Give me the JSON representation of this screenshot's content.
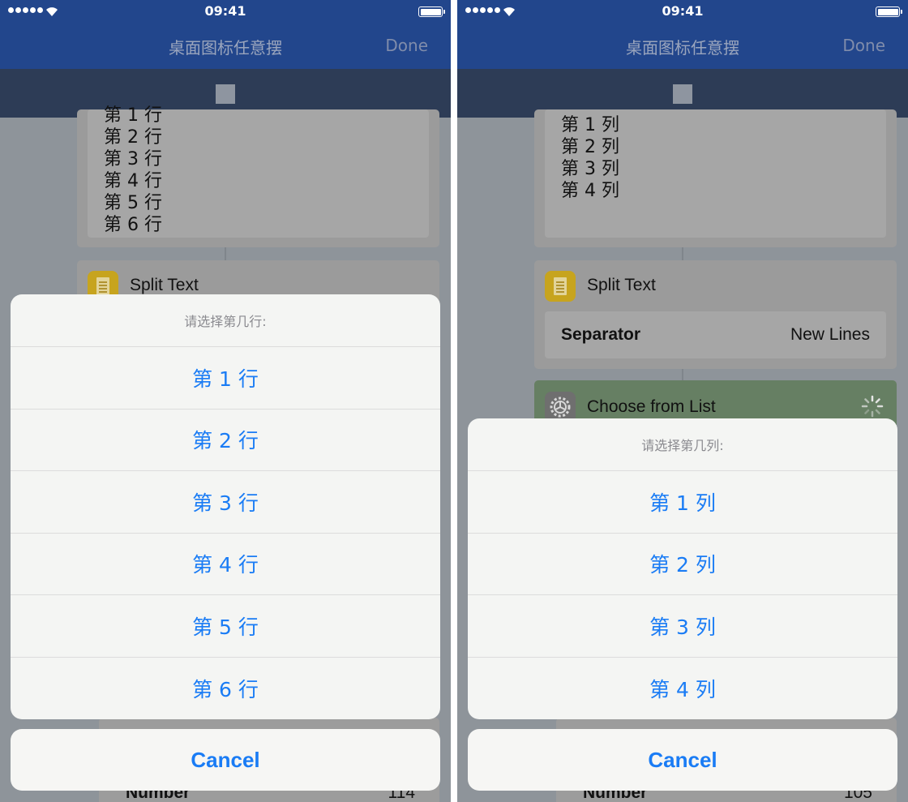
{
  "status": {
    "time": "09:41"
  },
  "colors": {
    "nav": "#22468c",
    "toolbar": "#2d3c56",
    "accent": "#1a7cf5",
    "choose_card": "#667f63",
    "split_icon": "#c7a41e"
  },
  "icons": {
    "run": "stop-icon",
    "text": "document-icon",
    "action": "gear-icon",
    "loading": "spinner-icon"
  },
  "left": {
    "nav": {
      "title": "桌面图标任意摆",
      "done": "Done"
    },
    "text_lines": [
      "第 1 行",
      "第 2 行",
      "第 3 行",
      "第 4 行",
      "第 5 行",
      "第 6 行"
    ],
    "split_card": {
      "title": "Split Text"
    },
    "below_card": {
      "label": "Number",
      "value": "114"
    },
    "sheet": {
      "title": "请选择第几行:",
      "options": [
        "第 1 行",
        "第 2 行",
        "第 3 行",
        "第 4 行",
        "第 5 行",
        "第 6 行"
      ],
      "cancel": "Cancel"
    }
  },
  "right": {
    "nav": {
      "title": "桌面图标任意摆",
      "done": "Done"
    },
    "text_lines": [
      "第 1 列",
      "第 2 列",
      "第 3 列",
      "第 4 列"
    ],
    "split_card": {
      "title": "Split Text",
      "separator_label": "Separator",
      "separator_value": "New Lines"
    },
    "choose_card": {
      "title": "Choose from List"
    },
    "below_card": {
      "label": "Number",
      "value": "105"
    },
    "sheet": {
      "title": "请选择第几列:",
      "options": [
        "第 1 列",
        "第 2 列",
        "第 3 列",
        "第 4 列"
      ],
      "cancel": "Cancel"
    }
  }
}
